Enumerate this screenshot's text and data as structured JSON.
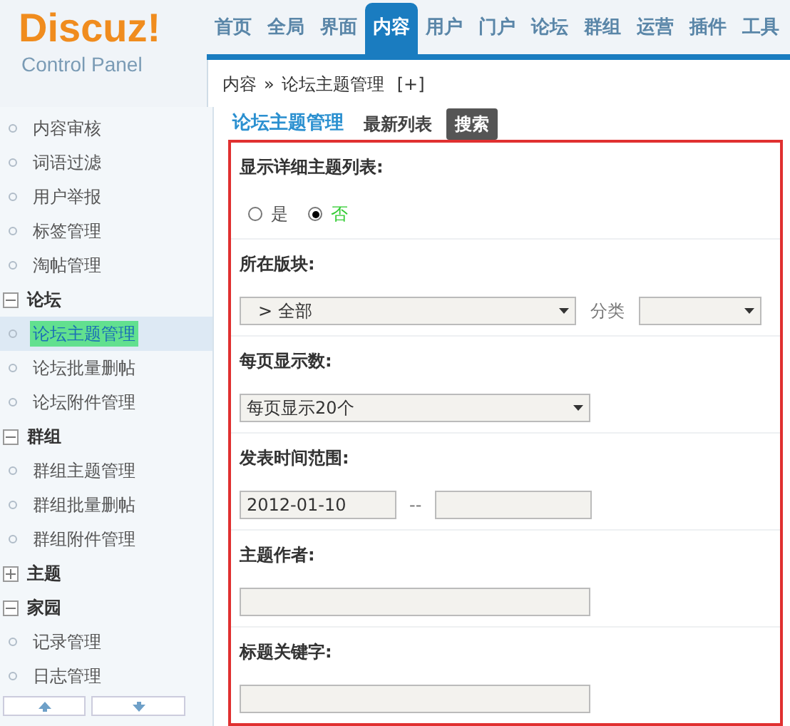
{
  "logo": {
    "title": "Discuz!",
    "subtitle": "Control Panel"
  },
  "nav": [
    {
      "label": "首页",
      "selected": false
    },
    {
      "label": "全局",
      "selected": false
    },
    {
      "label": "界面",
      "selected": false
    },
    {
      "label": "内容",
      "selected": true
    },
    {
      "label": "用户",
      "selected": false
    },
    {
      "label": "门户",
      "selected": false
    },
    {
      "label": "论坛",
      "selected": false
    },
    {
      "label": "群组",
      "selected": false
    },
    {
      "label": "运营",
      "selected": false
    },
    {
      "label": "插件",
      "selected": false
    },
    {
      "label": "工具",
      "selected": false
    }
  ],
  "breadcrumb": {
    "section": "内容",
    "separator": "»",
    "page": "论坛主题管理",
    "add": "[+]"
  },
  "sidebar": {
    "items": [
      {
        "kind": "item",
        "label": "内容审核",
        "selected": false
      },
      {
        "kind": "item",
        "label": "词语过滤",
        "selected": false
      },
      {
        "kind": "item",
        "label": "用户举报",
        "selected": false
      },
      {
        "kind": "item",
        "label": "标签管理",
        "selected": false
      },
      {
        "kind": "item",
        "label": "淘帖管理",
        "selected": false
      },
      {
        "kind": "group",
        "label": "论坛",
        "expanded": true,
        "children": [
          {
            "kind": "item",
            "label": "论坛主题管理",
            "selected": true
          },
          {
            "kind": "item",
            "label": "论坛批量删帖",
            "selected": false
          },
          {
            "kind": "item",
            "label": "论坛附件管理",
            "selected": false
          }
        ]
      },
      {
        "kind": "group",
        "label": "群组",
        "expanded": true,
        "children": [
          {
            "kind": "item",
            "label": "群组主题管理",
            "selected": false
          },
          {
            "kind": "item",
            "label": "群组批量删帖",
            "selected": false
          },
          {
            "kind": "item",
            "label": "群组附件管理",
            "selected": false
          }
        ]
      },
      {
        "kind": "group",
        "label": "主题",
        "expanded": false
      },
      {
        "kind": "group",
        "label": "家园",
        "expanded": true,
        "children": [
          {
            "kind": "item",
            "label": "记录管理",
            "selected": false
          },
          {
            "kind": "item",
            "label": "日志管理",
            "selected": false
          }
        ]
      }
    ]
  },
  "page": {
    "title": "论坛主题管理",
    "tabs": [
      {
        "label": "最新列表",
        "selected": false
      },
      {
        "label": "搜索",
        "selected": true
      }
    ]
  },
  "form": [
    {
      "kind": "radio",
      "label": "显示详细主题列表:",
      "options": [
        {
          "label": "是",
          "selected": false
        },
        {
          "label": "否",
          "selected": true
        }
      ]
    },
    {
      "kind": "forum",
      "label": "所在版块:",
      "value": "> 全部",
      "category_label": "分类"
    },
    {
      "kind": "select",
      "label": "每页显示数:",
      "value": "每页显示20个"
    },
    {
      "kind": "daterange",
      "label": "发表时间范围:",
      "from": "2012-01-10",
      "separator": "--"
    },
    {
      "kind": "text",
      "label": "主题作者:"
    },
    {
      "kind": "text",
      "label": "标题关键字:"
    }
  ]
}
